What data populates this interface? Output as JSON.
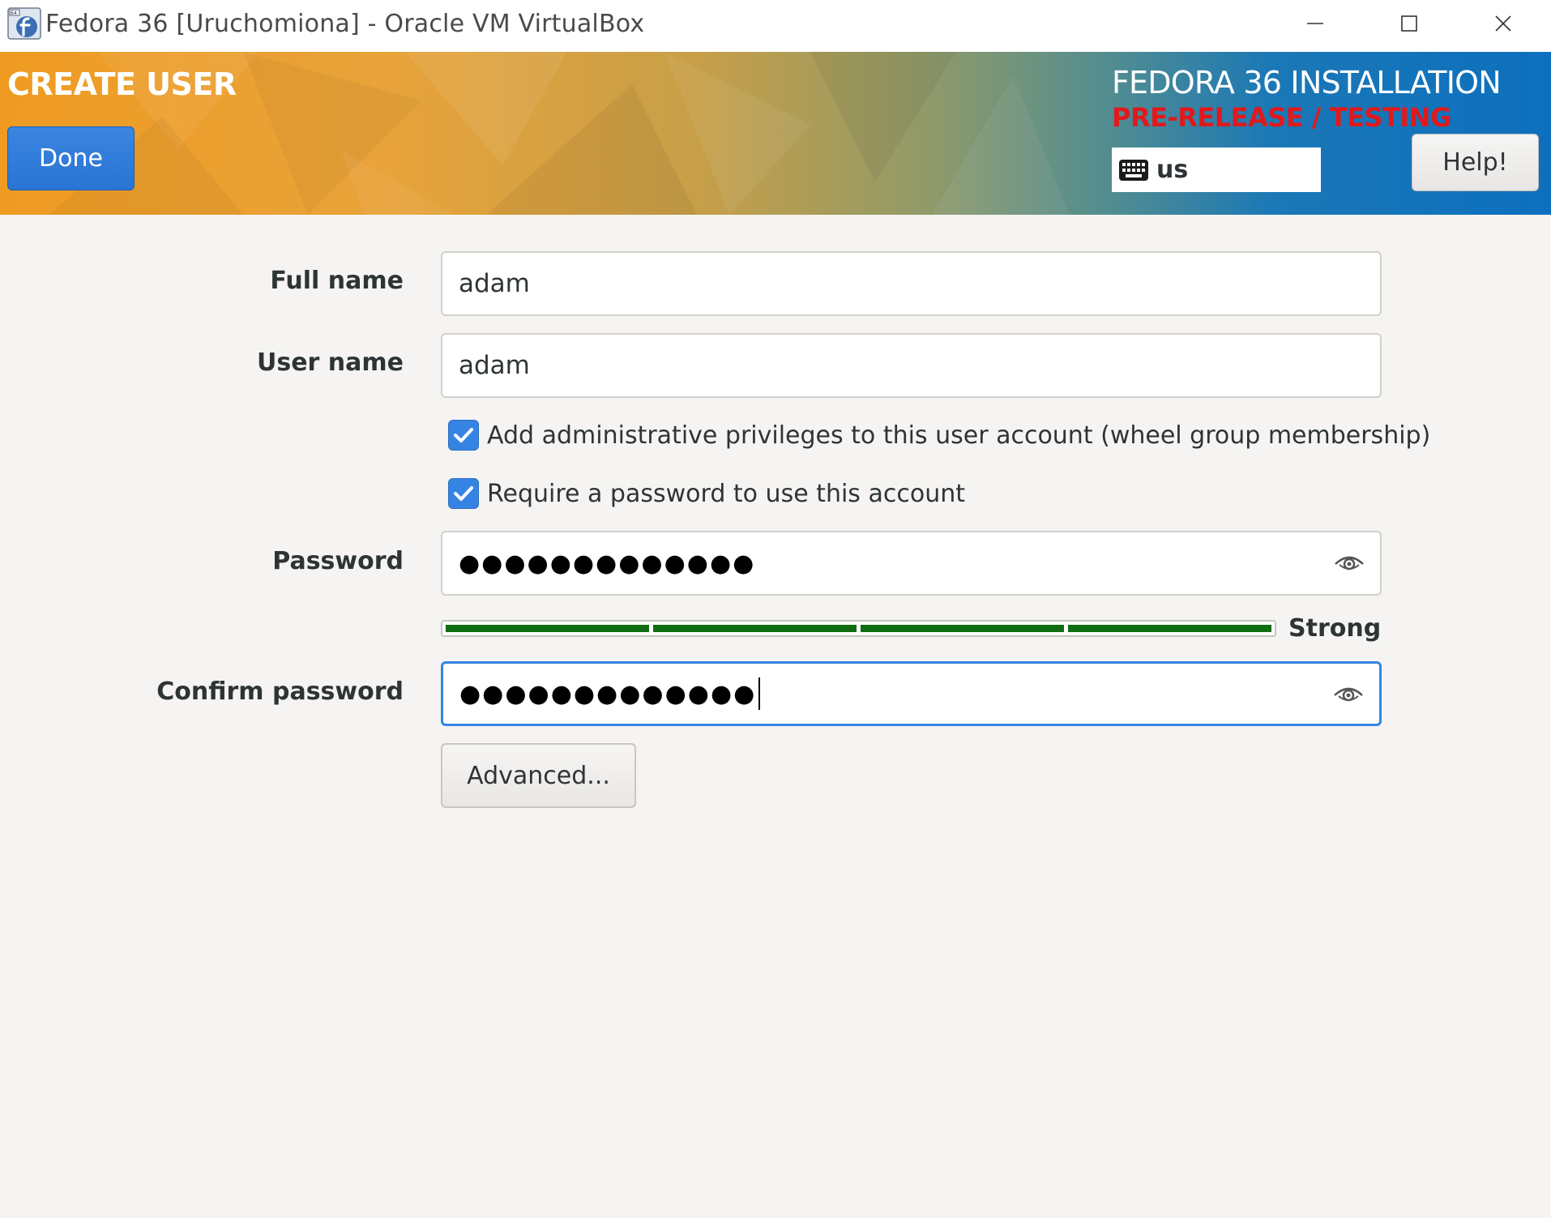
{
  "window": {
    "title": "Fedora 36 [Uruchomiona] - Oracle VM VirtualBox",
    "icon": "virtualbox-fedora-icon"
  },
  "header": {
    "page_title": "CREATE USER",
    "done_label": "Done",
    "product_title": "FEDORA 36 INSTALLATION",
    "prerelease_label": "PRE-RELEASE / TESTING",
    "keyboard_layout": "us",
    "help_label": "Help!",
    "colors": {
      "done_button": "#3584e4",
      "prerelease": "#e0191c"
    }
  },
  "form": {
    "full_name": {
      "label": "Full name",
      "value": "adam"
    },
    "user_name": {
      "label": "User name",
      "value": "adam"
    },
    "admin_checkbox": {
      "label": "Add administrative privileges to this user account (wheel group membership)",
      "checked": true
    },
    "require_password_checkbox": {
      "label": "Require a password to use this account",
      "checked": true
    },
    "password": {
      "label": "Password",
      "masked_value": "●●●●●●●●●●●●●"
    },
    "strength": {
      "label": "Strong",
      "level": 4,
      "max": 4,
      "color": "#116d11"
    },
    "confirm_password": {
      "label": "Confirm password",
      "masked_value": "●●●●●●●●●●●●●"
    },
    "advanced_label": "Advanced..."
  }
}
